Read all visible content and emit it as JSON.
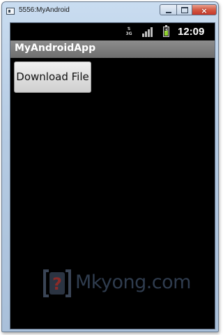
{
  "window": {
    "title": "5556:MyAndroid",
    "controls": {
      "minimize": "",
      "maximize": "",
      "close": "×"
    }
  },
  "statusbar": {
    "network": "3G",
    "time": "12:09"
  },
  "app": {
    "title": "MyAndroidApp",
    "download_button_label": "Download File"
  },
  "watermark": {
    "text": "Mkyong.com",
    "logo_glyph": "?"
  },
  "colors": {
    "screen_background": "#000000",
    "battery_fill": "#8fd12b",
    "close_button": "#c6382a",
    "watermark_accent": "#7a2a27"
  }
}
